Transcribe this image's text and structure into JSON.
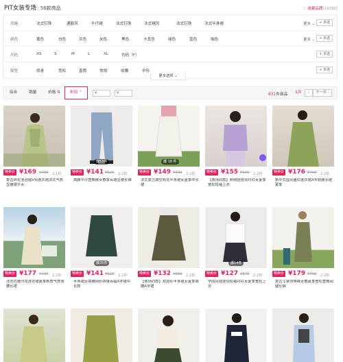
{
  "header": {
    "store_name": "PIT女装专场",
    "item_count": "56款商品",
    "favorite_label": "♡ 收藏品牌",
    "favorite_count": "(14790)"
  },
  "filters": {
    "more_label": "更多 ⌄",
    "multi_label": "+ 多选",
    "rows": [
      {
        "label": "风格",
        "options": [
          "法式钉珠",
          "通勤风",
          "牛仔裙",
          "法式钉珠",
          "法式裙风",
          "法式钉珠",
          "法式半身裙"
        ]
      },
      {
        "label": "颜色",
        "options": [
          "黄色",
          "白色",
          "灰色",
          "米色",
          "黑色",
          "卡其色",
          "绿色",
          "蓝色",
          "咖色"
        ]
      },
      {
        "label": "尺码",
        "options": [
          "XS",
          "S",
          "M",
          "L",
          "XL",
          "均码（F）"
        ]
      },
      {
        "label": "版型",
        "options": [
          "修身",
          "宽松",
          "直筒",
          "常规",
          "收腰",
          "伞形"
        ]
      }
    ],
    "more_options": "更多选项 ⌄"
  },
  "sortbar": {
    "comprehensive": "综合",
    "sales": "销量",
    "price": "价格 ⇅",
    "discount": "折扣 ⌃",
    "price_min": "¥",
    "price_max": "¥",
    "total_num": "831",
    "total_suffix": "件商品",
    "page": "1/5",
    "prev": "‹",
    "next": "下一页 ›"
  },
  "products": [
    {
      "tag": "特卖价",
      "price": "¥169",
      "orig": "¥799",
      "disc": "2.1折",
      "title": "复古碎花泡泡袖V领连衣裙法式气质显瘦裙子女",
      "overlay": ""
    },
    {
      "tag": "特卖价",
      "price": "¥141",
      "orig": "¥629",
      "disc": "2.2折",
      "title": "高腰牛仔直筒裤女春季百搭显瘦长裤",
      "overlay": "爆53件"
    },
    {
      "tag": "特卖价",
      "price": "¥149",
      "orig": "¥699",
      "disc": "2.2折",
      "title": "法式复古镂空钩花半身裙女夏季中长裙",
      "overlay": "爆 18 件"
    },
    {
      "tag": "特卖价",
      "price": "¥155",
      "orig": "¥699",
      "disc": "2.2折",
      "title": "【商场同款】刺绣娃娃领衬衫女夏季宽松短袖上衣",
      "overlay": ""
    },
    {
      "tag": "特卖价",
      "price": "¥176",
      "orig": "¥799",
      "disc": "2.2折",
      "title": "新中式国风盘扣连衣裙A字收腰长裙夏季",
      "overlay": ""
    },
    {
      "tag": "特卖价",
      "price": "¥177",
      "orig": "¥799",
      "disc": "2.2折",
      "title": "法式优雅印花连衣裙夏季新款气质收腰长裙",
      "overlay": ""
    },
    {
      "tag": "特卖价",
      "price": "¥141",
      "orig": "¥629",
      "disc": "2.2折",
      "title": "半身裙女高腰网纱拼接百褶A字裙中长款",
      "overlay": "爆35件"
    },
    {
      "tag": "特卖价",
      "price": "¥132",
      "orig": "¥599",
      "disc": "2.2折",
      "title": "【商场同款】双层纱半身裙女夏季高腰A字裙",
      "overlay": ""
    },
    {
      "tag": "特卖价",
      "price": "¥127",
      "orig": "¥579",
      "disc": "2.2折",
      "title": "学院风娃娃领短袖衬衫女夏季宽松上衣",
      "overlay": "爆14件"
    },
    {
      "tag": "特卖价",
      "price": "¥179",
      "orig": "¥799",
      "disc": "2.2折",
      "title": "复古工装背带裤女春夏季宽松直筒阔腿长裤",
      "overlay": ""
    }
  ],
  "colors": {
    "accent": "#e0245e",
    "bubble": "#7a59ff"
  }
}
